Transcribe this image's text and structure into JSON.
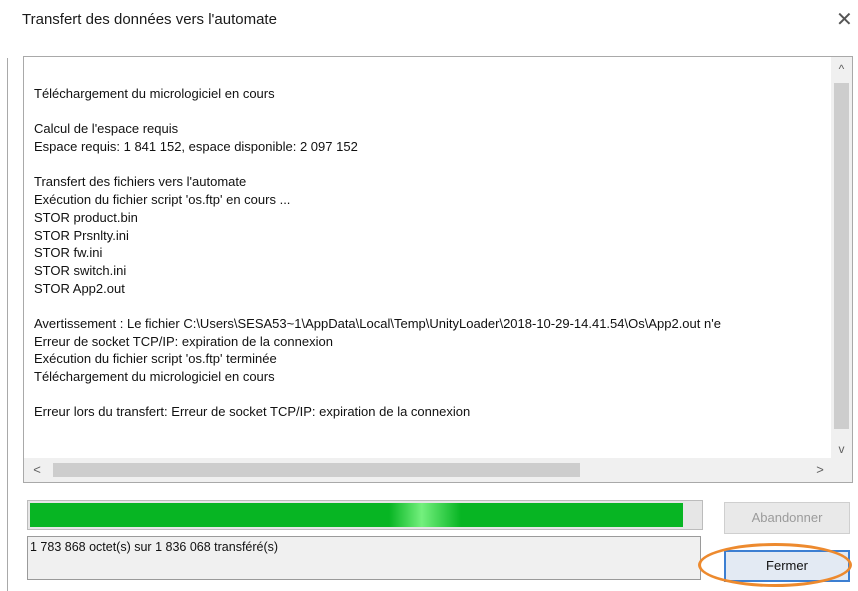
{
  "window": {
    "title": "Transfert des données vers l'automate",
    "close_glyph": "✕",
    "close_icon": "close-icon"
  },
  "log": {
    "lines": [
      "Téléchargement du micrologiciel en cours",
      "",
      "Calcul de l'espace requis",
      "Espace requis: 1 841 152, espace disponible: 2 097 152",
      "",
      "Transfert des fichiers vers l'automate",
      "Exécution du fichier script 'os.ftp' en cours ...",
      "STOR product.bin",
      "STOR Prsnlty.ini",
      "STOR fw.ini",
      "STOR switch.ini",
      "STOR App2.out",
      "",
      "Avertissement : Le fichier C:\\Users\\SESA53~1\\AppData\\Local\\Temp\\UnityLoader\\2018-10-29-14.41.54\\Os\\App2.out n'e",
      "Erreur de socket TCP/IP: expiration de la connexion",
      "Exécution du fichier script 'os.ftp' terminée",
      "Téléchargement du micrologiciel en cours",
      "",
      "Erreur lors du transfert: Erreur de socket TCP/IP: expiration de la connexion"
    ],
    "scroll_up_glyph": "^",
    "scroll_down_glyph": "v",
    "scroll_left_glyph": "<",
    "scroll_right_glyph": ">"
  },
  "progress": {
    "fraction": 0.971,
    "color": "#07b523"
  },
  "status": {
    "text": "1 783 868 octet(s) sur 1 836 068 transféré(s)"
  },
  "buttons": {
    "abort_label": "Abandonner",
    "close_label": "Fermer"
  },
  "colors": {
    "highlight": "#ed8a2e",
    "focus_border": "#3c7fd2"
  }
}
